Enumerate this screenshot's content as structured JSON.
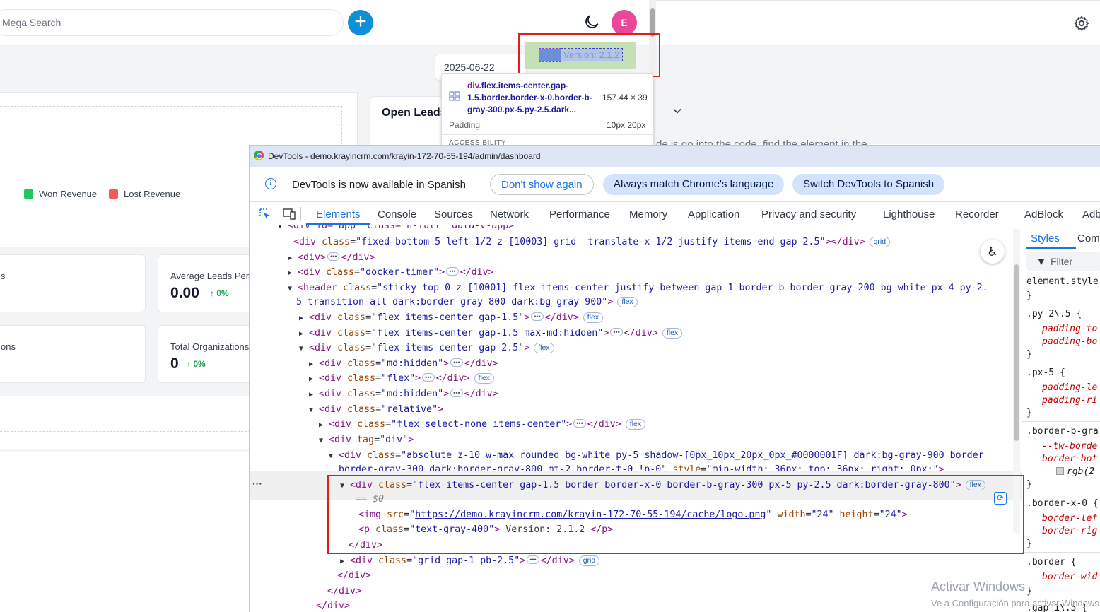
{
  "app": {
    "search_placeholder": "Mega Search",
    "avatar_initial": "E",
    "date_value": "2025-06-22",
    "version_text": "Version: 2.1.2",
    "open_leads_title": "Open Leads",
    "behind_text": "de is go into the code, find the element in the",
    "legend": [
      {
        "label": "Won Revenue",
        "color": "#22c55e"
      },
      {
        "label": "Lost Revenue",
        "color": "#f05a5a"
      }
    ],
    "stats": [
      {
        "label": "s",
        "value": "",
        "pct": ""
      },
      {
        "label": "Average Leads Per D",
        "value": "0.00",
        "pct": "0%"
      },
      {
        "label": "ons",
        "value": "",
        "pct": ""
      },
      {
        "label": "Total Organizations",
        "value": "0",
        "pct": "0%"
      }
    ],
    "accent_color": "#0e90d9"
  },
  "tooltip": {
    "selector_tag": "div",
    "selector_classes": ".flex.items-center.gap-1.5.border.border-x-0.border-b-gray-300.px-5.py-2.5.dark...",
    "size": "157.44 × 39",
    "padding_label": "Padding",
    "padding_value": "10px 20px",
    "accessibility_label": "ACCESSIBILITY"
  },
  "devtools": {
    "title": "DevTools - demo.krayincrm.com/krayin-172-70-55-194/admin/dashboard",
    "info_message": "DevTools is now available in Spanish",
    "buttons": {
      "dont_show": "Don't show again",
      "match_language": "Always match Chrome's language",
      "switch_spanish": "Switch DevTools to Spanish"
    },
    "tabs": [
      "Elements",
      "Console",
      "Sources",
      "Network",
      "Performance",
      "Memory",
      "Application",
      "Privacy and security",
      "Lighthouse",
      "Recorder",
      "AdBlock",
      "Adb"
    ],
    "dom": {
      "l0": "<div id=\"app\" class=\"h-full\" data-v-app>",
      "l1_tag": "<div",
      "l1_attr": " class=",
      "l1_val": "\"fixed bottom-5 left-1/2 z-[10003] grid -translate-x-1/2 justify-items-end gap-2.5\"",
      "l1_end": "></div>",
      "l2": "<div>",
      "l3_val": "\"docker-timer\"",
      "l4_val": "\"sticky top-0 z-[10001] flex items-center justify-between gap-1 border-b border-gray-200 bg-white px-4 py-2.",
      "l4b_val": "5 transition-all dark:border-gray-800 dark:bg-gray-900\"",
      "l5_val": "\"flex items-center gap-1.5\"",
      "l6_val": "\"flex items-center gap-1.5 max-md:hidden\"",
      "l7_val": "\"flex items-center gap-2.5\"",
      "l8_val": "\"md:hidden\"",
      "l9_val": "\"flex\"",
      "l10_val": "\"md:hidden\"",
      "l11_val": "\"relative\"",
      "l12_val": "\"flex select-none items-center\"",
      "l13_val": "\"div\"",
      "l14_val": "\"absolute z-10 w-max rounded bg-white py-5 shadow-[0px_10px_20px_0px_#0000001F] dark:bg-gray-900 border",
      "l14b_val": "border-gray-300 dark:border-gray-800 mt-2 border-t-0 !p-0\"",
      "l14b_style": "\"min-width: 36px; top: 36px; right: 0px;\"",
      "l15_val": "\"flex items-center gap-1.5 border border-x-0 border-b-gray-300 px-5 py-2.5 dark:border-gray-800\"",
      "eq": "== $0",
      "l16_src": "https://demo.krayincrm.com/krayin-172-70-55-194/cache/logo.png",
      "l16_w": "\"24\"",
      "l16_h": "\"24\"",
      "l17_val": "\"text-gray-400\"",
      "l17_text": " Version: 2.1.2 ",
      "l19_val": "\"grid gap-1 pb-2.5\"",
      "badge_grid": "grid",
      "badge_flex": "flex"
    },
    "styles": {
      "tabs": [
        "Styles",
        "Com"
      ],
      "filter_placeholder": "Filter",
      "rules": [
        "element.style {",
        "}",
        ".py-2\\.5 {",
        "padding-to",
        "padding-bo",
        "}",
        ".px-5 {",
        "padding-le",
        "padding-ri",
        "}",
        ".border-b-gra",
        "--tw-borde",
        "border-bot",
        "rgb(2",
        "}",
        ".border-x-0 {",
        "border-lef",
        "border-rig",
        "}",
        ".border {",
        "border-wid",
        "}",
        ".gap-1\\.5 {"
      ]
    }
  },
  "watermark": {
    "line1": "Activar Windows",
    "line2": "Ve a Configuración para activar Windows."
  }
}
